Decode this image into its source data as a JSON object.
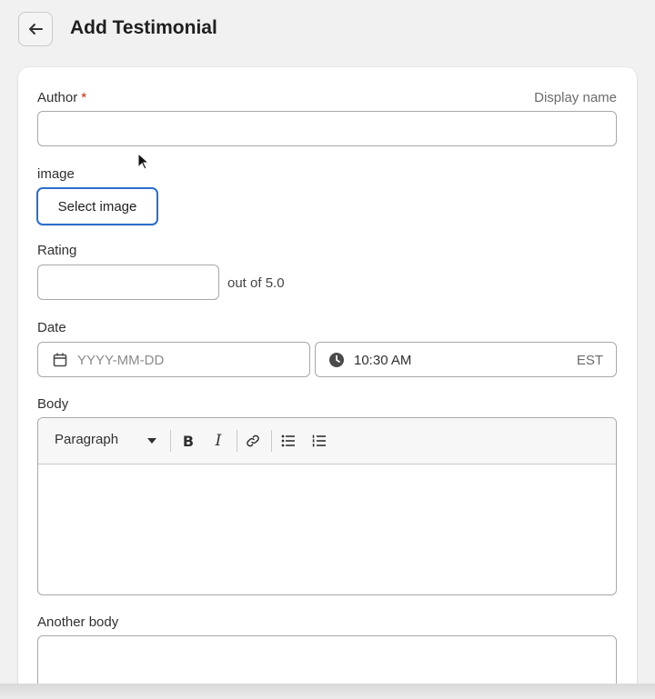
{
  "header": {
    "title": "Add Testimonial",
    "back_icon": "arrow-left-icon"
  },
  "form": {
    "author": {
      "label": "Author",
      "required_mark": "*",
      "hint": "Display name",
      "value": ""
    },
    "image": {
      "label": "image",
      "button_label": "Select image"
    },
    "rating": {
      "label": "Rating",
      "value": "",
      "suffix": "out of 5.0"
    },
    "date": {
      "label": "Date",
      "date_placeholder": "YYYY-MM-DD",
      "time_value": "10:30 AM",
      "timezone": "EST"
    },
    "body": {
      "label": "Body",
      "format_select": "Paragraph",
      "toolbar_icons": [
        "bold-icon",
        "italic-icon",
        "link-icon",
        "bullet-list-icon",
        "numbered-list-icon"
      ]
    },
    "another_body": {
      "label": "Another body"
    }
  },
  "colors": {
    "accent": "#2c6ecb",
    "required": "#c5280c",
    "background": "#f1f1f1"
  }
}
